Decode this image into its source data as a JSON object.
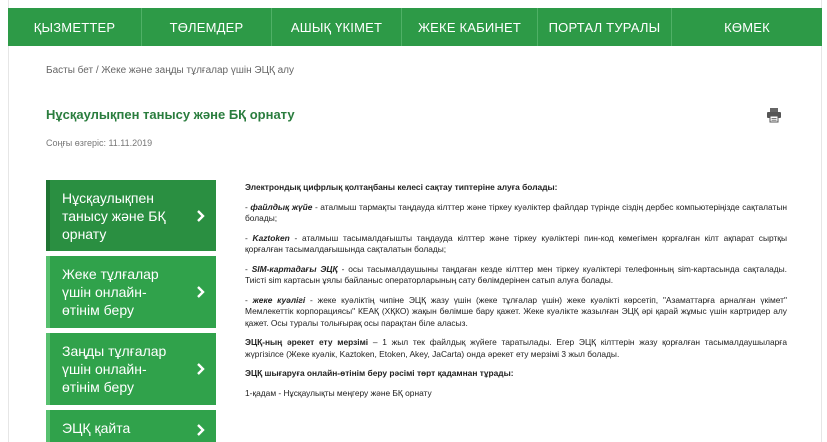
{
  "nav": {
    "items": [
      "ҚЫЗМЕТТЕР",
      "ТӨЛЕМДЕР",
      "АШЫҚ ҮКІМЕТ",
      "ЖЕКЕ КАБИНЕТ",
      "ПОРТАЛ ТУРАЛЫ",
      "КӨМЕК"
    ]
  },
  "breadcrumb": "Басты бет / Жеке және заңды тұлғалар үшін ЭЦҚ алу",
  "page": {
    "title": "Нұсқаулықпен танысу және БҚ орнату",
    "last_modified": "Соңғы өзгеріс: 11.11.2019"
  },
  "sidebar": {
    "items": [
      {
        "label": "Нұсқаулықпен танысу және БҚ орнату"
      },
      {
        "label": "Жеке тұлғалар үшін онлайн-өтінім беру"
      },
      {
        "label": "Заңды тұлғалар үшін онлайн-өтінім беру"
      },
      {
        "label": "ЭЦҚ қайта шығару"
      }
    ]
  },
  "content": {
    "intro": "Электрондық цифрлық қолтаңбаны келесі сақтау типтеріне алуға болады:",
    "p1_term": "файлдық жүйе",
    "p1_text": " - аталмыш тармақты таңдауда кілттер және тіркеу куәліктер файлдар түрінде сіздің дербес компьютеріңізде сақталатын болады;",
    "p2_term": "Kaztoken",
    "p2_text": " - аталмыш тасымалдағышты таңдауда кілттер және тіркеу куәліктері пин-код көмегімен қорғалған кілт ақпарат сыртқы қорғалған тасымалдағышында сақталатын болады;",
    "p3_term": "SIM-картадағы ЭЦҚ",
    "p3_text": " - осы тасымалдаушыны таңдаған кезде кілттер мен тіркеу куәліктері телефонның sim-картасында сақталады. Тиісті sim картасын ұялы байланыс операторларының сату бөлімдерінен сатып алуға болады.",
    "p4_term": "жеке куәлігі",
    "p4_text": " - жеке куәліктің чипіне ЭЦҚ жазу үшін (жеке тұлғалар үшін) жеке куәлікті көрсетіп, \"Азаматтарға арналған үкімет\" Мемлекеттік корпорациясы\" КЕАҚ (ХҚКО) жақын бөлімше бару қажет. Жеке куәлікте жазылған ЭЦҚ әрі қарай жұмыс үшін картридер алу қажет. Осы туралы толығырақ осы парақтан біле аласыз.",
    "p5_term": "ЭЦҚ-ның әрекет ету мерзімі",
    "p5_text": " – 1 жыл тек файлдық жүйеге таратылады. Егер ЭЦҚ кілттерін жазу қорғалған тасымалдаушыларға жүргізілсе (Жеке куәлік, Kaztoken, Etoken, Akey, JaCarta) онда әрекет ету мерзімі 3 жыл болады.",
    "p6": "ЭЦҚ шығаруға онлайн-өтінім беру рәсімі төрт қадамнан тұрады:",
    "p7": "1-қадам - Нұсқаулықты меңгеру және БҚ орнату"
  },
  "icons": {
    "print": "printer-icon",
    "chevron": "chevron-right-icon"
  },
  "colors": {
    "brand_green": "#2d9a47",
    "title_green": "#2a7d3e"
  }
}
